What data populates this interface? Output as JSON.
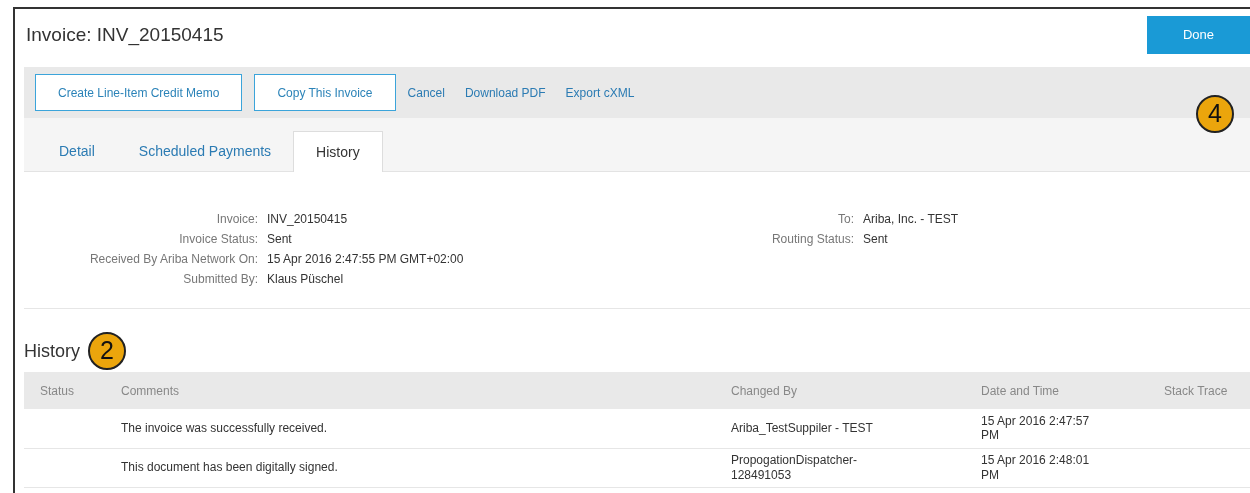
{
  "header": {
    "title": "Invoice: INV_20150415",
    "done_button": "Done"
  },
  "toolbar": {
    "callout": "4",
    "buttons": [
      "Create Line-Item Credit Memo",
      "Copy This Invoice"
    ],
    "links": [
      "Cancel",
      "Download PDF",
      "Export cXML"
    ]
  },
  "tabs": [
    {
      "label": "Detail",
      "selected": false
    },
    {
      "label": "Scheduled Payments",
      "selected": false
    },
    {
      "label": "History",
      "selected": true
    }
  ],
  "details_left": [
    {
      "label": "Invoice:",
      "value": "INV_20150415"
    },
    {
      "label": "Invoice Status:",
      "value": "Sent"
    },
    {
      "label": "Received By Ariba Network On:",
      "value": "15 Apr 2016 2:47:55 PM GMT+02:00"
    },
    {
      "label": "Submitted By:",
      "value": "Klaus Püschel"
    }
  ],
  "details_right": [
    {
      "label": "To:",
      "value": "Ariba, Inc. - TEST"
    },
    {
      "label": "Routing Status:",
      "value": "Sent"
    }
  ],
  "history": {
    "title": "History",
    "callout": "2",
    "table": {
      "columns": [
        "Status",
        "Comments",
        "Changed By",
        "Date and Time",
        "Stack Trace"
      ],
      "rows": [
        [
          "",
          "The invoice was successfully received.",
          "Ariba_TestSuppiler - TEST",
          "15 Apr 2016 2:47:57 PM",
          ""
        ],
        [
          "",
          "This document has been digitally signed.",
          "PropogationDispatcher-128491053",
          "15 Apr 2016 2:48:01 PM",
          ""
        ]
      ]
    }
  }
}
